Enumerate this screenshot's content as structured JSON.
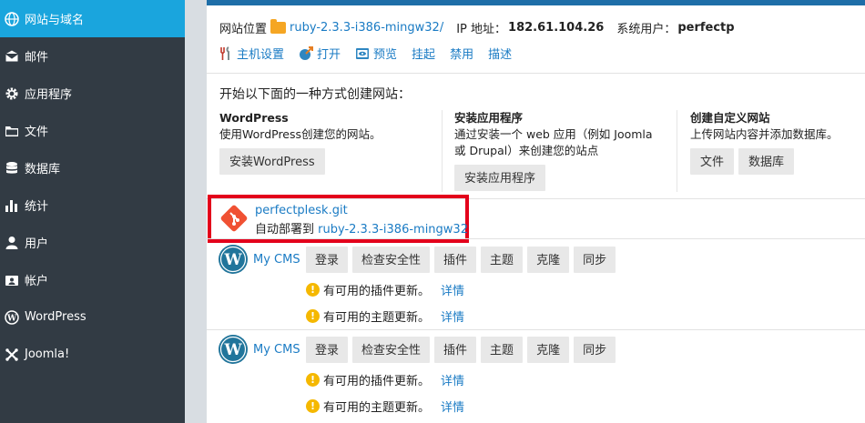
{
  "sidebar": {
    "items": [
      {
        "label": "网站与域名",
        "icon": "globe-icon",
        "active": true
      },
      {
        "label": "邮件",
        "icon": "mail-icon"
      },
      {
        "label": "应用程序",
        "icon": "gear-icon"
      },
      {
        "label": "文件",
        "icon": "folder-icon"
      },
      {
        "label": "数据库",
        "icon": "database-icon"
      },
      {
        "label": "统计",
        "icon": "bar-chart-icon"
      },
      {
        "label": "用户",
        "icon": "user-icon"
      },
      {
        "label": "帐户",
        "icon": "account-icon"
      },
      {
        "label": "WordPress",
        "icon": "wordpress-icon"
      },
      {
        "label": "Joomla!",
        "icon": "joomla-icon"
      }
    ]
  },
  "site": {
    "location_label": "网站位置",
    "location_value": "ruby-2.3.3-i386-mingw32/",
    "ip_label": "IP 地址：",
    "ip_value": "182.61.104.26",
    "user_label": "系统用户：",
    "user_value": "perfectp"
  },
  "actions": [
    {
      "label": "主机设置",
      "icon": "wrench-icon"
    },
    {
      "label": "打开",
      "icon": "open-icon"
    },
    {
      "label": "预览",
      "icon": "preview-icon"
    },
    {
      "label": "挂起"
    },
    {
      "label": "禁用"
    },
    {
      "label": "描述"
    }
  ],
  "create": {
    "title": "开始以下面的一种方式创建网站：",
    "wordpress": {
      "title": "WordPress",
      "desc": "使用WordPress创建您的网站。",
      "button": "安装WordPress"
    },
    "apps": {
      "title": "安装应用程序",
      "desc1": "通过安装一个 web 应用（例如 Joomla",
      "desc2": "或 Drupal）来创建您的站点",
      "button": "安装应用程序"
    },
    "custom": {
      "title": "创建自定义网站",
      "desc": "上传网站内容并添加数据库。",
      "button_files": "文件",
      "button_db": "数据库"
    }
  },
  "git": {
    "repo": "perfectplesk.git",
    "deploy_label": "自动部署到",
    "deploy_target": "ruby-2.3.3-i386-mingw32"
  },
  "cms": [
    {
      "name": "My CMS",
      "buttons": [
        "登录",
        "检查安全性",
        "插件",
        "主题",
        "克隆",
        "同步"
      ],
      "notices": [
        {
          "text": "有可用的插件更新。",
          "link": "详情"
        },
        {
          "text": "有可用的主题更新。",
          "link": "详情"
        }
      ]
    },
    {
      "name": "My CMS",
      "buttons": [
        "登录",
        "检查安全性",
        "插件",
        "主题",
        "克隆",
        "同步"
      ],
      "notices": [
        {
          "text": "有可用的插件更新。",
          "link": "详情"
        },
        {
          "text": "有可用的主题更新。",
          "link": "详情"
        }
      ]
    }
  ],
  "colors": {
    "sidebar_bg": "#323b44",
    "sidebar_active": "#1aa5dd",
    "link": "#1a7bc4",
    "highlight_border": "#e3001b",
    "git_orange": "#f05133",
    "warning": "#f5b800"
  }
}
